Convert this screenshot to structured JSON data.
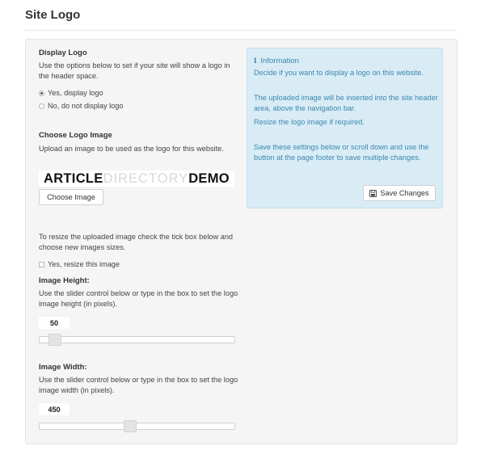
{
  "page": {
    "title": "Site Logo"
  },
  "display_logo": {
    "heading": "Display Logo",
    "description": "Use the options below to set if your site will show a logo in the header space.",
    "options": [
      {
        "label": "Yes, display logo",
        "checked": true
      },
      {
        "label": "No, do not display logo",
        "checked": false
      }
    ]
  },
  "choose_logo": {
    "heading": "Choose Logo Image",
    "description": "Upload an image to be used as the logo for this website.",
    "logo_parts": [
      "ARTICLE",
      "DIRECTORY",
      "DEMO"
    ],
    "button_label": "Choose Image"
  },
  "resize": {
    "description": "To resize the uploaded image check the tick box below and choose new images sizes.",
    "checkbox_label": "Yes, resize this image",
    "checkbox_checked": false
  },
  "image_height": {
    "heading": "Image Height:",
    "description": "Use the slider control below or type in the box to set the logo image height (in pixels).",
    "value": "50",
    "slider_fraction": 0.05
  },
  "image_width": {
    "heading": "Image Width:",
    "description": "Use the slider control below or type in the box to set the logo image width (in pixels).",
    "value": "450",
    "slider_fraction": 0.46
  },
  "info": {
    "title": "Information",
    "icon": "info-icon",
    "line1": "Decide if you want to display a logo on this website.",
    "line2": "The uploaded image will be inserted into the site header area, above the navigation bar.",
    "line3": "Resize the logo image if required.",
    "line4": "Save these settings below or scroll down and use the button at the page footer to save multiple changes.",
    "save_label": "Save Changes"
  },
  "colors": {
    "info_bg": "#d9ecf6",
    "info_text": "#3a87ad",
    "panel_bg": "#f5f5f5"
  }
}
